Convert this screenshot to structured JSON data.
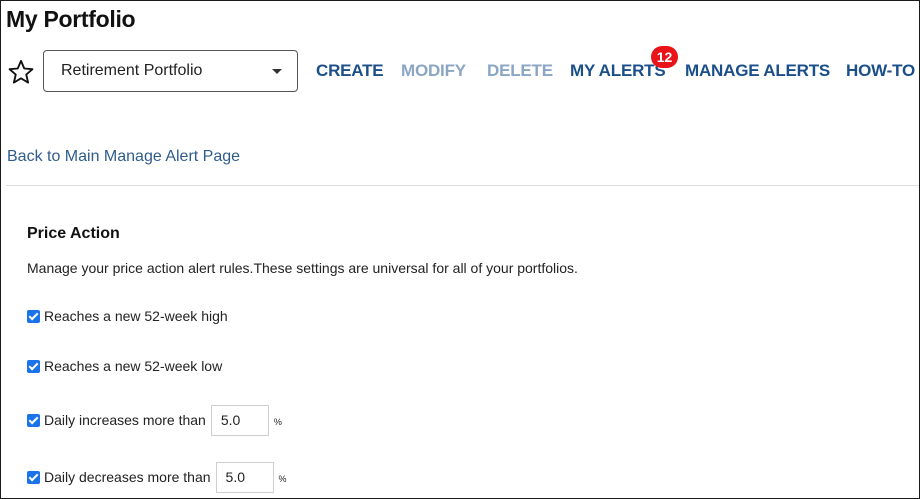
{
  "header": {
    "title": "My Portfolio"
  },
  "portfolio_select": {
    "selected": "Retirement Portfolio"
  },
  "nav": {
    "create": "CREATE",
    "modify": "MODIFY",
    "delete": "DELETE",
    "my_alerts": "MY ALERTS",
    "my_alerts_count": "12",
    "manage_alerts": "MANAGE ALERTS",
    "how_to": "HOW-TO"
  },
  "back_link": "Back to Main Manage Alert Page",
  "price_action": {
    "heading": "Price Action",
    "description": "Manage your price action alert rules.These settings are universal for all of your portfolios.",
    "rules": [
      {
        "label": "Reaches a new 52-week high",
        "checked": true
      },
      {
        "label": "Reaches a new 52-week low",
        "checked": true
      },
      {
        "label": "Daily increases more than",
        "checked": true,
        "value": "5.0",
        "unit": "%"
      },
      {
        "label": "Daily decreases more than",
        "checked": true,
        "value": "5.0",
        "unit": "%"
      }
    ]
  },
  "colors": {
    "nav_active": "#1b4f8a",
    "nav_disabled": "#8aa6c4",
    "badge": "#e8141a",
    "checkbox": "#1a73e8",
    "link": "#2f5c8c"
  }
}
